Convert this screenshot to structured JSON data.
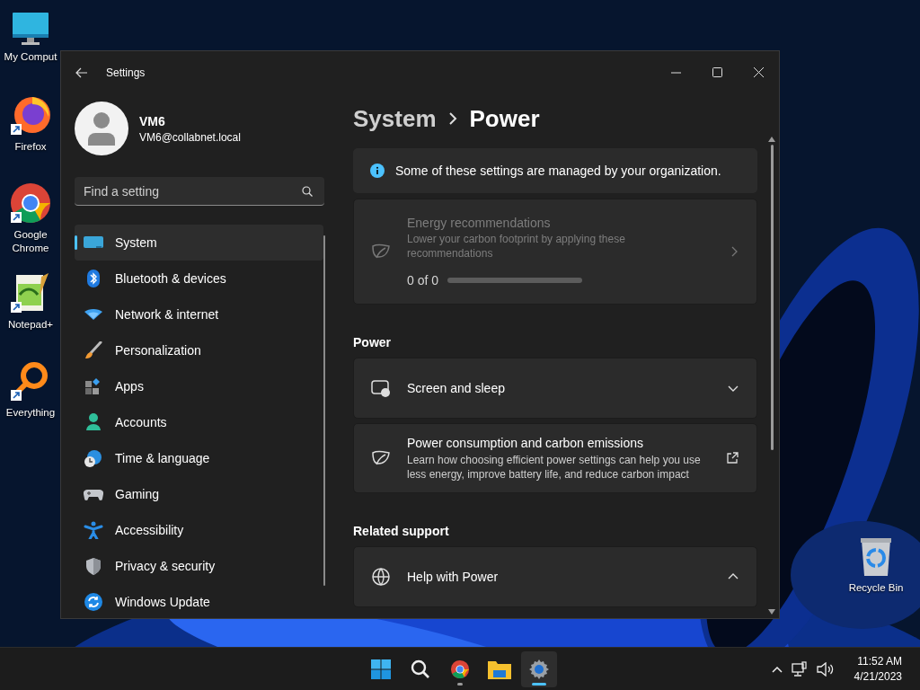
{
  "desktop_icons": [
    {
      "kind": "computer",
      "label": "My Comput"
    },
    {
      "kind": "firefox",
      "label": "Firefox"
    },
    {
      "kind": "chrome",
      "label": "Google Chrome"
    },
    {
      "kind": "notepad",
      "label": "Notepad+"
    },
    {
      "kind": "everything",
      "label": "Everything"
    },
    {
      "kind": "recycle",
      "label": "Recycle Bin"
    }
  ],
  "window": {
    "title": "Settings",
    "user": {
      "name": "VM6",
      "email": "VM6@collabnet.local"
    },
    "search": {
      "placeholder": "Find a setting"
    },
    "nav_items": [
      {
        "kind": "system",
        "label": "System",
        "selected": true
      },
      {
        "kind": "bluetooth",
        "label": "Bluetooth & devices",
        "selected": false
      },
      {
        "kind": "network",
        "label": "Network & internet",
        "selected": false
      },
      {
        "kind": "personalization",
        "label": "Personalization",
        "selected": false
      },
      {
        "kind": "apps",
        "label": "Apps",
        "selected": false
      },
      {
        "kind": "accounts",
        "label": "Accounts",
        "selected": false
      },
      {
        "kind": "time",
        "label": "Time & language",
        "selected": false
      },
      {
        "kind": "gaming",
        "label": "Gaming",
        "selected": false
      },
      {
        "kind": "accessibility",
        "label": "Accessibility",
        "selected": false
      },
      {
        "kind": "privacy",
        "label": "Privacy & security",
        "selected": false
      },
      {
        "kind": "update",
        "label": "Windows Update",
        "selected": false
      }
    ],
    "breadcrumb": {
      "parent": "System",
      "current": "Power"
    },
    "notice": "Some of these settings are managed by your organization.",
    "energy_card": {
      "title": "Energy recommendations",
      "description": "Lower your carbon footprint by applying these recommendations",
      "progress_text": "0 of 0",
      "disabled": true
    },
    "sections": [
      {
        "heading": "Power",
        "cards": [
          {
            "kind": "display",
            "title": "Screen and sleep",
            "expanded": false
          },
          {
            "kind": "external",
            "title": "Power consumption and carbon emissions",
            "description": "Learn how choosing efficient power settings can help you use less energy, improve battery life, and reduce carbon impact"
          }
        ]
      },
      {
        "heading": "Related support",
        "cards": [
          {
            "kind": "support",
            "title": "Help with Power",
            "expanded": true
          }
        ]
      }
    ]
  },
  "taskbar": {
    "apps": [
      {
        "kind": "start",
        "running": false,
        "active": false
      },
      {
        "kind": "search",
        "running": false,
        "active": false
      },
      {
        "kind": "chrome",
        "running": true,
        "active": false
      },
      {
        "kind": "explorer",
        "running": false,
        "active": false
      },
      {
        "kind": "settings",
        "running": true,
        "active": true
      }
    ],
    "clock": {
      "time": "11:52 AM",
      "date": "4/21/2023"
    }
  }
}
